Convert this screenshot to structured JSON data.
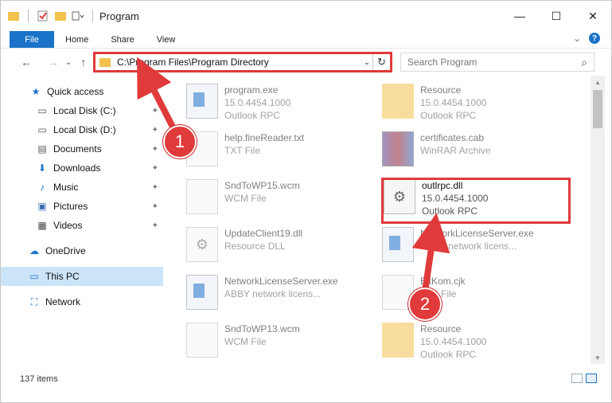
{
  "window": {
    "title": "Program",
    "controls": {
      "minimize": "—",
      "maximize": "☐",
      "close": "✕"
    }
  },
  "ribbon": {
    "tabs": [
      "File",
      "Home",
      "Share",
      "View"
    ],
    "expand": "⌄",
    "help": "?"
  },
  "nav": {
    "back": "←",
    "forward": "→",
    "recent": "⌄",
    "up": "↑",
    "address": "C:\\Program Files\\Program Directory",
    "address_dropdown": "⌄",
    "refresh": "↻",
    "search_placeholder": "Search Program",
    "search_icon": "⌕"
  },
  "sidebar": {
    "items": [
      {
        "label": "Quick access",
        "icon": "★",
        "pinned": false
      },
      {
        "label": "Local Disk (C:)",
        "icon": "▭",
        "pinned": true
      },
      {
        "label": "Local Disk (D:)",
        "icon": "▭",
        "pinned": true
      },
      {
        "label": "Documents",
        "icon": "▤",
        "pinned": true
      },
      {
        "label": "Downloads",
        "icon": "⬇",
        "pinned": true
      },
      {
        "label": "Music",
        "icon": "♪",
        "pinned": true
      },
      {
        "label": "Pictures",
        "icon": "▣",
        "pinned": true
      },
      {
        "label": "Videos",
        "icon": "▦",
        "pinned": true
      },
      {
        "label": "OneDrive",
        "icon": "☁",
        "pinned": false
      },
      {
        "label": "This PC",
        "icon": "▭",
        "pinned": false,
        "selected": true
      },
      {
        "label": "Network",
        "icon": "⛶",
        "pinned": false
      }
    ],
    "pin_glyph": "📌"
  },
  "files": [
    {
      "name": "program.exe",
      "line1": "15.0.4454.1000",
      "line2": "Outlook RPC",
      "icon": "app"
    },
    {
      "name": "Resource",
      "line1": "15.0.4454.1000",
      "line2": "Outlook RPC",
      "icon": "folder"
    },
    {
      "name": "help.fineReader.txt",
      "line1": "TXT File",
      "line2": "",
      "icon": "doc"
    },
    {
      "name": "certificates.cab",
      "line1": "WinRAR Archive",
      "line2": "",
      "icon": "rar"
    },
    {
      "name": "SndToWP15.wcm",
      "line1": "WCM File",
      "line2": "",
      "icon": "doc"
    },
    {
      "name": "outlrpc.dll",
      "line1": "15.0.4454.1000",
      "line2": "Outlook RPC",
      "icon": "gear",
      "highlighted": true
    },
    {
      "name": "UpdateClient19.dll",
      "line1": "Resource DLL",
      "line2": "",
      "icon": "gear"
    },
    {
      "name": "NetworkLicenseServer.exe",
      "line1": "ABBY network licens...",
      "line2": "",
      "icon": "app"
    },
    {
      "name": "NetworkLicenseServer.exe",
      "line1": "ABBY network licens...",
      "line2": "",
      "icon": "app"
    },
    {
      "name": "BitKom.cjk",
      "line1": "CJK File",
      "line2": "",
      "icon": "doc"
    },
    {
      "name": "SndToWP13.wcm",
      "line1": "WCM File",
      "line2": "",
      "icon": "doc"
    },
    {
      "name": "Resource",
      "line1": "15.0.4454.1000",
      "line2": "Outlook RPC",
      "icon": "folder"
    }
  ],
  "status": {
    "count": "137 items"
  },
  "annotations": {
    "badge1": "1",
    "badge2": "2"
  },
  "colors": {
    "accent": "#1a73c8",
    "highlight": "#e03a3a",
    "selection": "#cce4f7"
  }
}
